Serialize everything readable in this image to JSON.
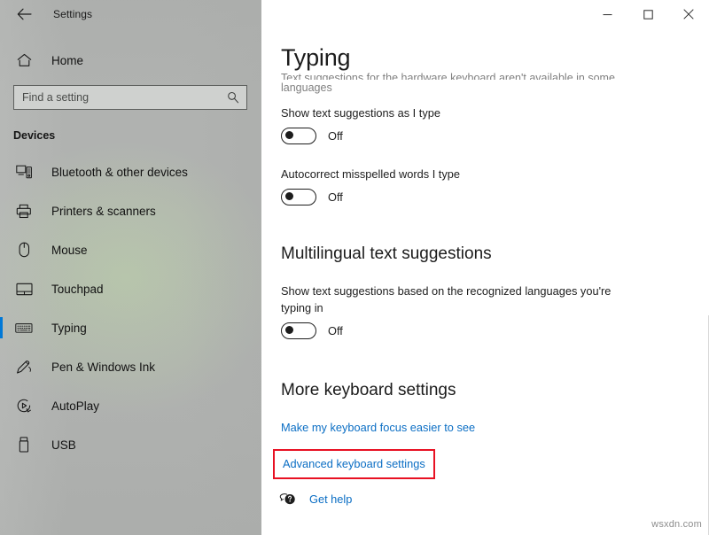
{
  "window": {
    "app_title": "Settings",
    "back_icon": "back-arrow-icon",
    "controls": {
      "minimize": "minimize-icon",
      "maximize": "maximize-icon",
      "close": "close-icon"
    }
  },
  "sidebar": {
    "home": {
      "label": "Home",
      "icon": "home-icon"
    },
    "search": {
      "placeholder": "Find a setting",
      "value": "",
      "icon": "search-icon"
    },
    "group_header": "Devices",
    "accent_color": "#0078d7",
    "items": [
      {
        "label": "Bluetooth & other devices",
        "icon": "bluetooth-devices-icon",
        "selected": false
      },
      {
        "label": "Printers & scanners",
        "icon": "printer-icon",
        "selected": false
      },
      {
        "label": "Mouse",
        "icon": "mouse-icon",
        "selected": false
      },
      {
        "label": "Touchpad",
        "icon": "touchpad-icon",
        "selected": false
      },
      {
        "label": "Typing",
        "icon": "keyboard-icon",
        "selected": true
      },
      {
        "label": "Pen & Windows Ink",
        "icon": "pen-icon",
        "selected": false
      },
      {
        "label": "AutoPlay",
        "icon": "autoplay-icon",
        "selected": false
      },
      {
        "label": "USB",
        "icon": "usb-icon",
        "selected": false
      }
    ]
  },
  "main": {
    "page_title": "Typing",
    "scrolled_note_line1": "Text suggestions for the hardware keyboard aren't available in some",
    "scrolled_note_line2": "languages",
    "settings": [
      {
        "label": "Show text suggestions as I type",
        "toggle_state": "Off",
        "toggle_on": false
      },
      {
        "label": "Autocorrect misspelled words I type",
        "toggle_state": "Off",
        "toggle_on": false
      }
    ],
    "multilingual": {
      "heading": "Multilingual text suggestions",
      "label_line1": "Show text suggestions based on the recognized languages you're",
      "label_line2": "typing in",
      "toggle_state": "Off",
      "toggle_on": false
    },
    "more_keyboard": {
      "heading": "More keyboard settings",
      "links": [
        {
          "label": "Make my keyboard focus easier to see",
          "highlighted": false
        },
        {
          "label": "Advanced keyboard settings",
          "highlighted": true
        }
      ],
      "highlight_color": "#e81123",
      "link_color": "#0b6ec4"
    },
    "get_help": {
      "label": "Get help",
      "icon": "help-bubble-icon"
    }
  },
  "watermark": "wsxdn.com"
}
